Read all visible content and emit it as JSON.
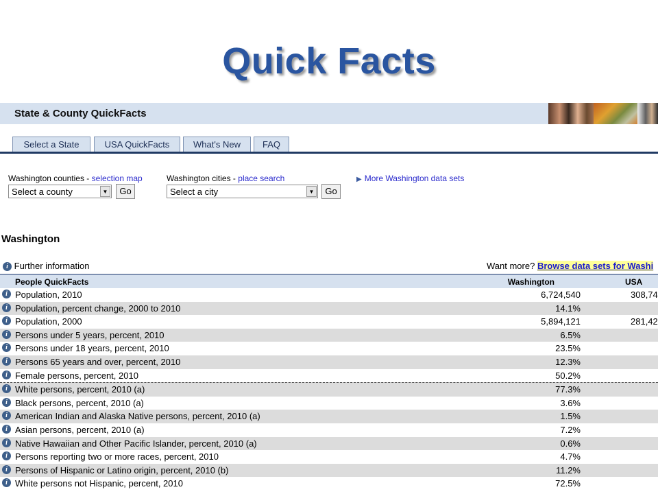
{
  "slide_title": "Quick Facts",
  "header": {
    "title": "State & County QuickFacts"
  },
  "tabs": [
    "Select a State",
    "USA QuickFacts",
    "What's New",
    "FAQ"
  ],
  "counties": {
    "label": "Washington counties - ",
    "link": "selection map",
    "select_value": "Select a county",
    "go": "Go"
  },
  "cities": {
    "label": "Washington cities - ",
    "link": "place search",
    "select_value": "Select a city",
    "go": "Go"
  },
  "more_link": "More Washington data sets",
  "state_title": "Washington",
  "further_info": "Further information",
  "want_more": {
    "prefix": "Want more? ",
    "link": "Browse data sets for Washi"
  },
  "table": {
    "columns": [
      "People QuickFacts",
      "Washington",
      "USA"
    ],
    "rows": [
      {
        "label": "Population, 2010",
        "wa": "6,724,540",
        "us": "308,74"
      },
      {
        "label": "Population, percent change, 2000 to 2010",
        "wa": "14.1%",
        "us": ""
      },
      {
        "label": "Population, 2000",
        "wa": "5,894,121",
        "us": "281,42"
      },
      {
        "label": "Persons under 5 years, percent, 2010",
        "wa": "6.5%",
        "us": ""
      },
      {
        "label": "Persons under 18 years, percent, 2010",
        "wa": "23.5%",
        "us": ""
      },
      {
        "label": "Persons 65 years and over, percent, 2010",
        "wa": "12.3%",
        "us": ""
      },
      {
        "label": "Female persons, percent, 2010",
        "wa": "50.2%",
        "us": ""
      },
      {
        "label": "White persons, percent, 2010 (a)",
        "wa": "77.3%",
        "us": ""
      },
      {
        "label": "Black persons, percent, 2010 (a)",
        "wa": "3.6%",
        "us": ""
      },
      {
        "label": "American Indian and Alaska Native persons, percent, 2010 (a)",
        "wa": "1.5%",
        "us": ""
      },
      {
        "label": "Asian persons, percent, 2010 (a)",
        "wa": "7.2%",
        "us": ""
      },
      {
        "label": "Native Hawaiian and Other Pacific Islander, percent, 2010 (a)",
        "wa": "0.6%",
        "us": ""
      },
      {
        "label": "Persons reporting two or more races, percent, 2010",
        "wa": "4.7%",
        "us": ""
      },
      {
        "label": "Persons of Hispanic or Latino origin, percent, 2010 (b)",
        "wa": "11.2%",
        "us": ""
      },
      {
        "label": "White persons not Hispanic, percent, 2010",
        "wa": "72.5%",
        "us": ""
      }
    ]
  },
  "colors": {
    "title": "#2a55a0",
    "header_bg": "#d6e1ef",
    "tab_border": "#203a63",
    "link": "#2a2acc",
    "row_shade": "#dcdcdc"
  }
}
